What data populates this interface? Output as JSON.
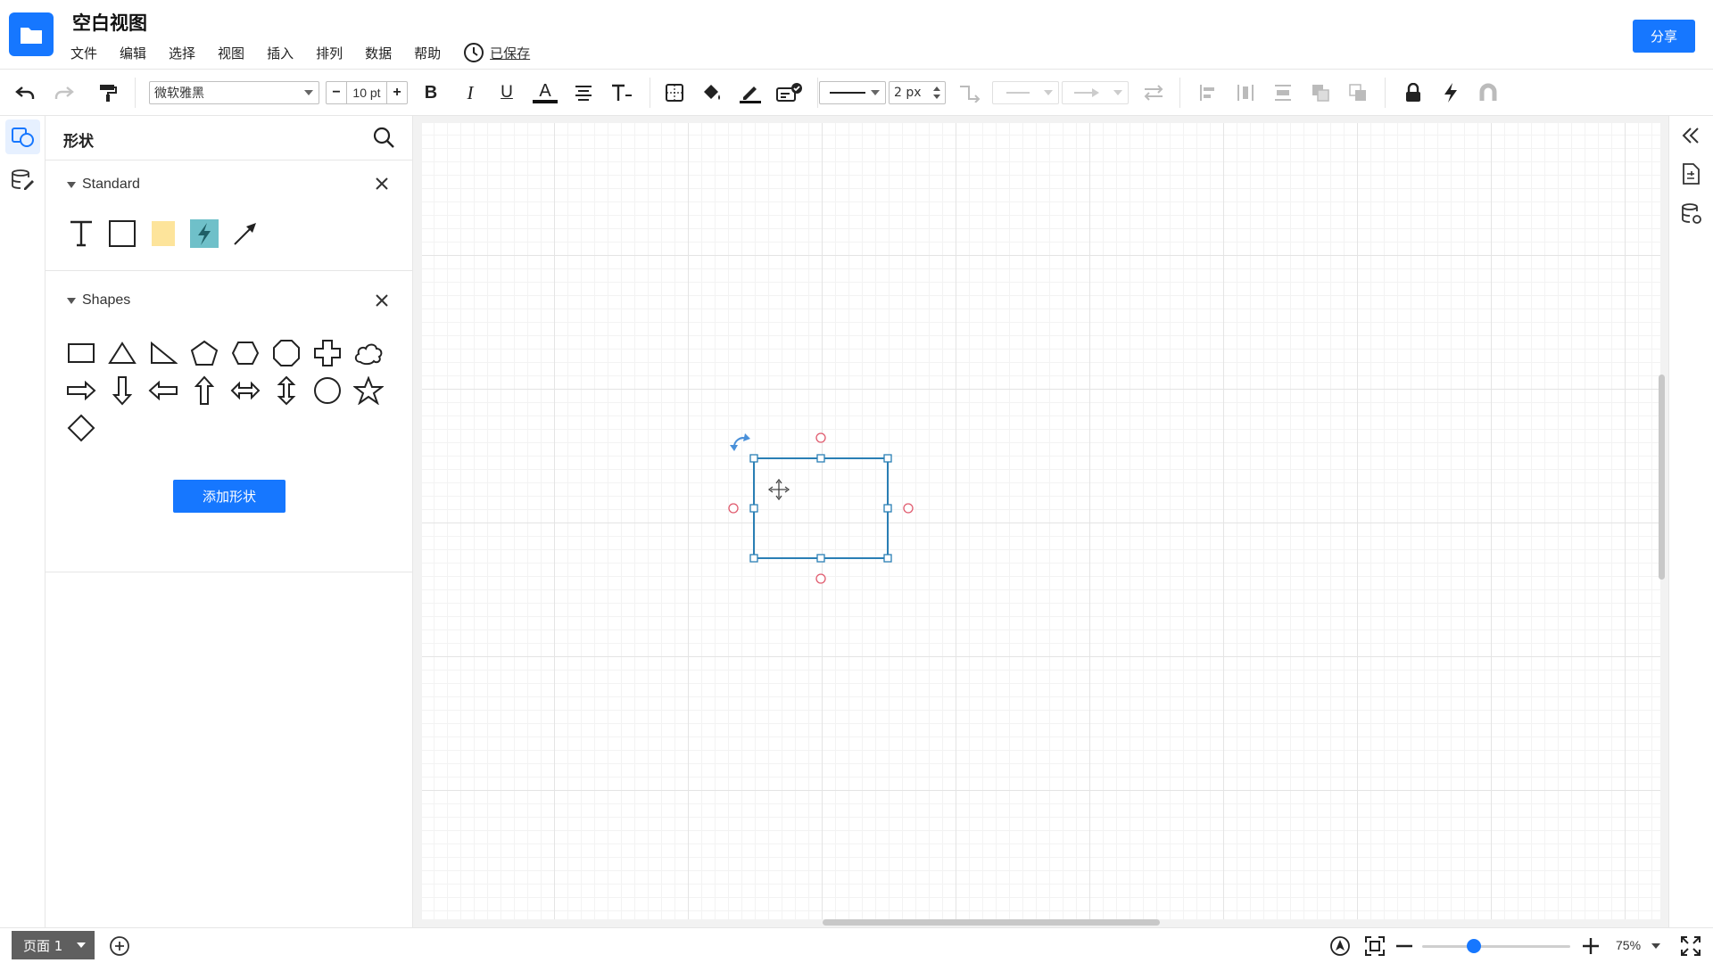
{
  "header": {
    "title": "空白视图",
    "menu": [
      "文件",
      "编辑",
      "选择",
      "视图",
      "插入",
      "排列",
      "数据",
      "帮助"
    ],
    "saved_label": "已保存",
    "share_label": "分享"
  },
  "toolbar": {
    "font_family": "微软雅黑",
    "font_size": "10 pt",
    "decrease_label": "−",
    "increase_label": "+",
    "bold_label": "B",
    "italic_label": "I",
    "underline_label": "U",
    "font_color_label": "A",
    "line_width": "2 px"
  },
  "shapes_panel": {
    "title": "形状",
    "sections": [
      {
        "name": "Standard",
        "items": [
          "text-icon",
          "rectangle-icon",
          "sticky-note-icon",
          "lightning-icon",
          "arrow-line-icon"
        ]
      },
      {
        "name": "Shapes",
        "items": [
          "rectangle-icon",
          "triangle-icon",
          "right-triangle-icon",
          "pentagon-icon",
          "hexagon-icon",
          "octagon-icon",
          "cross-icon",
          "cloud-icon",
          "right-arrow-icon",
          "down-arrow-icon",
          "left-arrow-icon",
          "up-arrow-icon",
          "left-right-arrow-icon",
          "up-down-arrow-icon",
          "circle-icon",
          "star-icon",
          "diamond-icon"
        ]
      }
    ],
    "add_shape_label": "添加形状"
  },
  "footer": {
    "page_label": "页面 1",
    "zoom_level": "75%",
    "zoom_fraction": 0.35
  },
  "colors": {
    "accent": "#1677ff",
    "selection": "#2a7fb5",
    "anchor": "#e05a6d"
  }
}
